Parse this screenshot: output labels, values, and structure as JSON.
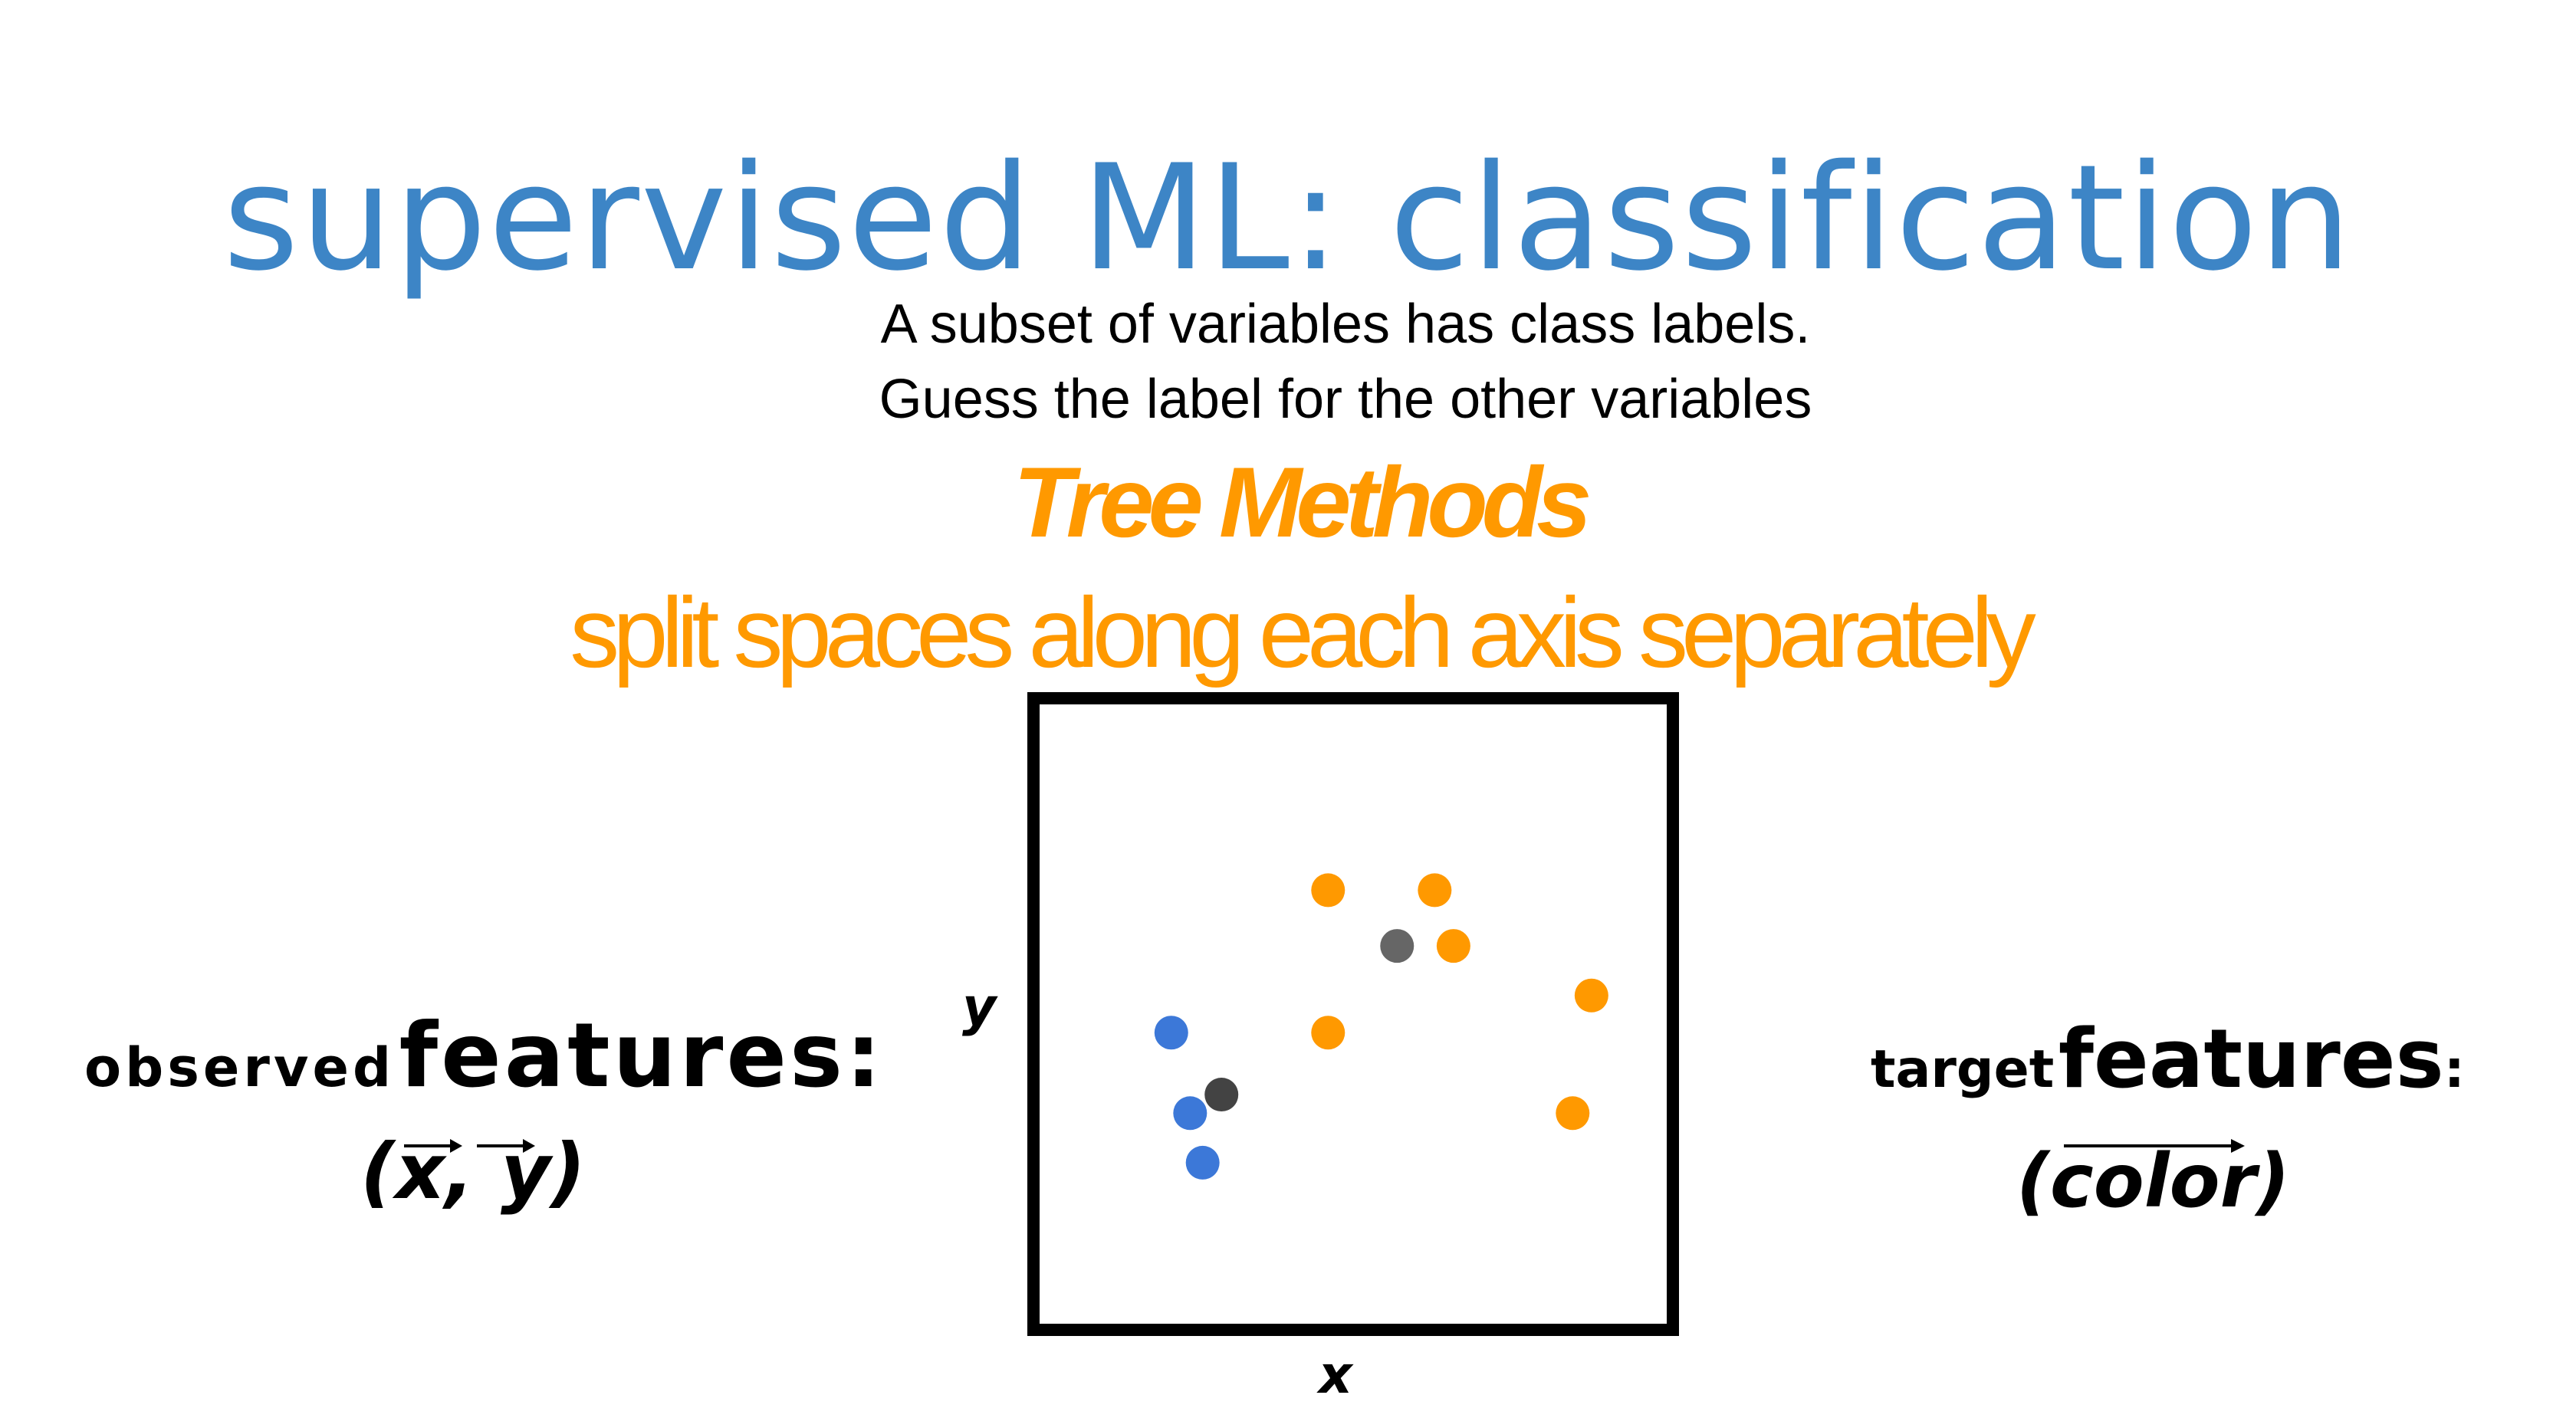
{
  "slide": {
    "title": "supervised ML: classification",
    "subtitle_line1": "A subset of variables has class labels.",
    "subtitle_line2": "Guess the label for the other variables",
    "method_heading": "Tree Methods",
    "method_tagline": "split spaces along each axis separately"
  },
  "left_panel": {
    "observed_label": "observed",
    "features_label": "features:",
    "vector": "(x, y)"
  },
  "right_panel": {
    "target_label": "target",
    "features_label": "features",
    "colon": ":",
    "vector": "(color)"
  },
  "colors": {
    "title": "#3d85c6",
    "accent": "#ff9900",
    "blue_point": "#3c78d8",
    "gray_point_light": "#666666",
    "gray_point_dark": "#434343"
  },
  "chart_data": {
    "type": "scatter",
    "xlabel": "x",
    "ylabel": "y",
    "xlim": [
      0,
      100
    ],
    "ylim": [
      0,
      100
    ],
    "grid": false,
    "series": [
      {
        "color": "#ff9900",
        "points": [
          [
            46,
            70
          ],
          [
            63,
            70
          ],
          [
            66,
            61
          ],
          [
            88,
            53
          ],
          [
            46,
            47
          ],
          [
            85,
            34
          ]
        ]
      },
      {
        "color": "#3c78d8",
        "points": [
          [
            21,
            47
          ],
          [
            24,
            34
          ],
          [
            26,
            26
          ]
        ]
      },
      {
        "color": "#666666",
        "points": [
          [
            57,
            61
          ]
        ]
      },
      {
        "color": "#434343",
        "points": [
          [
            29,
            37
          ]
        ]
      }
    ]
  }
}
